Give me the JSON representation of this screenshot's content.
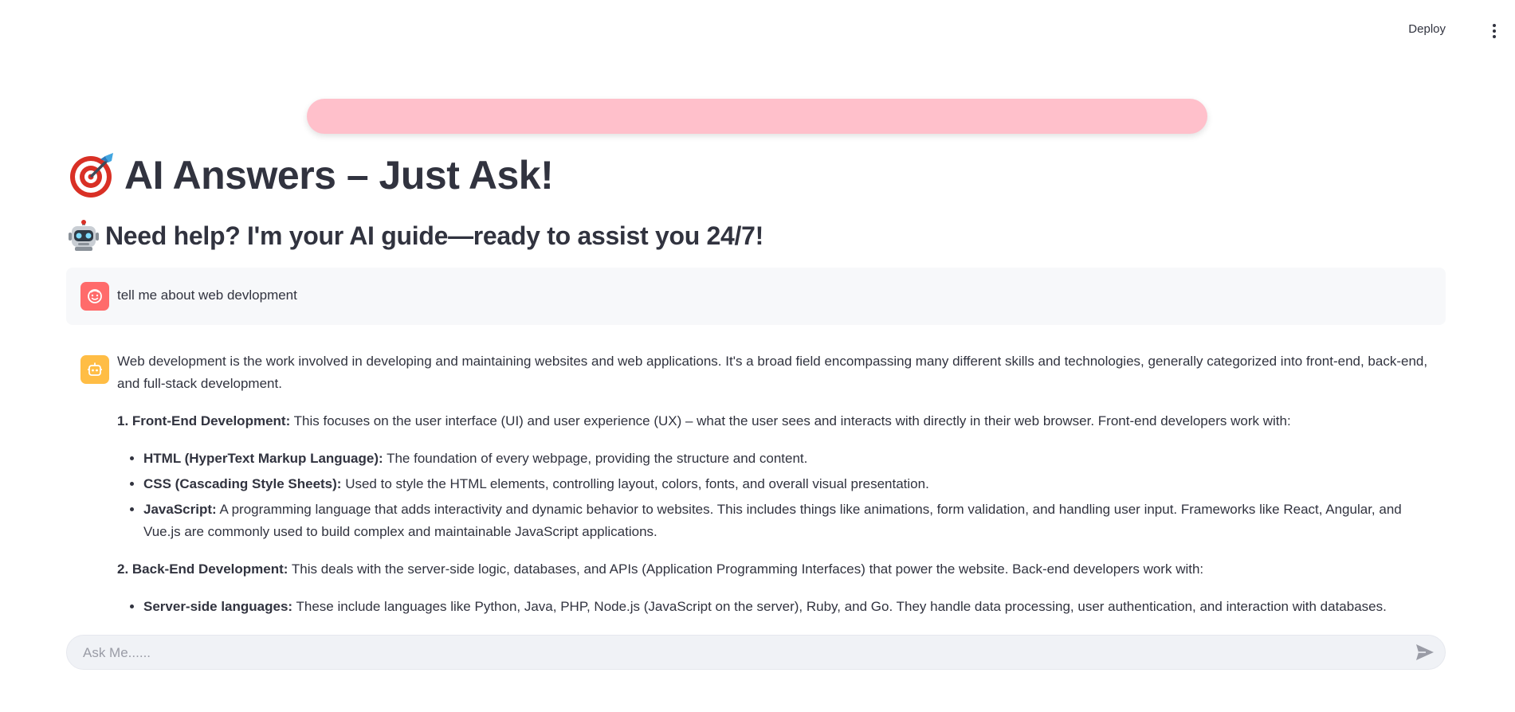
{
  "header": {
    "deploy_label": "Deploy",
    "menu_icon": "vertical-dots-icon"
  },
  "banner": {
    "color": "#ffc0cb"
  },
  "hero": {
    "title_icon": "target-dart-icon",
    "title": "AI Answers – Just Ask!",
    "subtitle_icon": "robot-icon",
    "subtitle": "Need help? I'm your AI guide—ready to assist you 24/7!"
  },
  "chat": {
    "user_message": {
      "avatar_icon": "user-face-icon",
      "avatar_color": "#ff6b6b",
      "text": "tell me about web devlopment"
    },
    "assistant_message": {
      "avatar_icon": "bot-icon",
      "avatar_color": "#ffbd45",
      "intro": "Web development is the work involved in developing and maintaining websites and web applications. It's a broad field encompassing many different skills and technologies, generally categorized into front-end, back-end, and full-stack development.",
      "section1": {
        "heading": "1. Front-End Development:",
        "text": " This focuses on the user interface (UI) and user experience (UX) – what the user sees and interacts with directly in their web browser. Front-end developers work with:",
        "items": [
          {
            "term": "HTML (HyperText Markup Language):",
            "desc": " The foundation of every webpage, providing the structure and content."
          },
          {
            "term": "CSS (Cascading Style Sheets):",
            "desc": " Used to style the HTML elements, controlling layout, colors, fonts, and overall visual presentation."
          },
          {
            "term": "JavaScript:",
            "desc": " A programming language that adds interactivity and dynamic behavior to websites. This includes things like animations, form validation, and handling user input. Frameworks like React, Angular, and Vue.js are commonly used to build complex and maintainable JavaScript applications."
          }
        ]
      },
      "section2": {
        "heading": "2. Back-End Development:",
        "text": " This deals with the server-side logic, databases, and APIs (Application Programming Interfaces) that power the website. Back-end developers work with:",
        "items": [
          {
            "term": "Server-side languages:",
            "desc": " These include languages like Python, Java, PHP, Node.js (JavaScript on the server), Ruby, and Go. They handle data processing, user authentication, and interaction with databases."
          }
        ]
      }
    }
  },
  "input": {
    "placeholder": "Ask Me......",
    "value": "",
    "send_icon": "send-arrow-icon"
  }
}
